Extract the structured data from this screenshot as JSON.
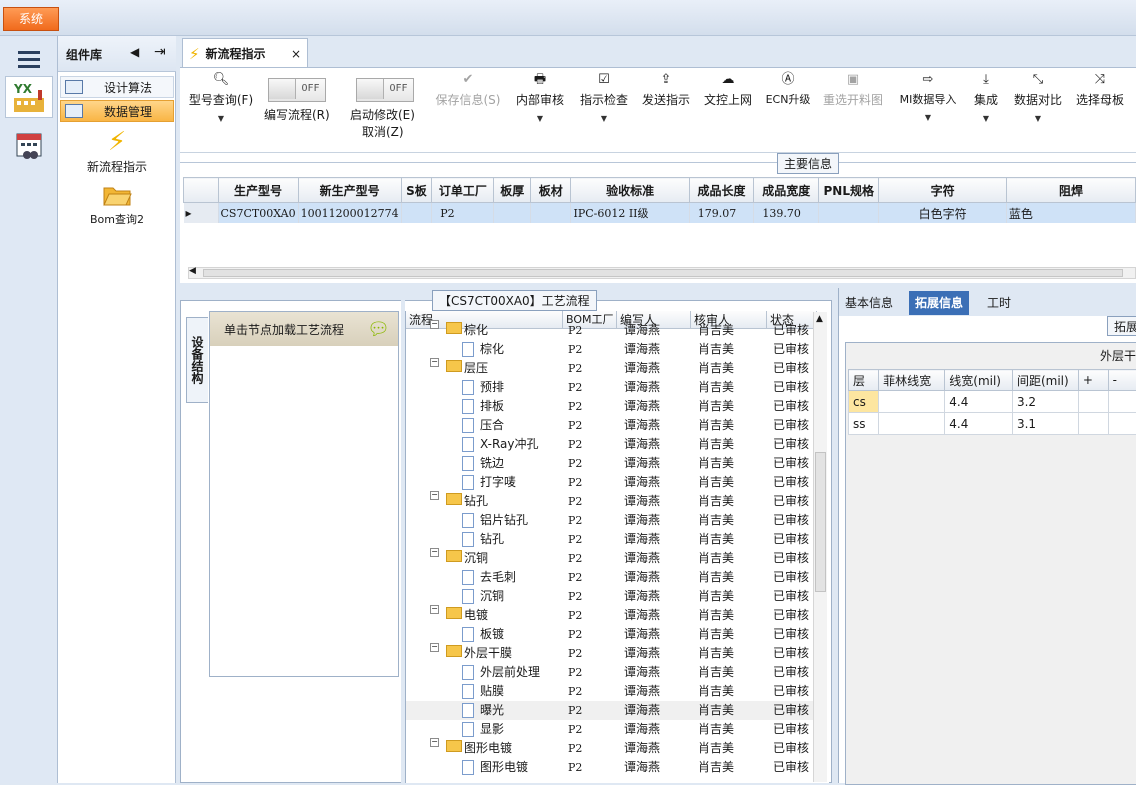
{
  "system_button": "系统",
  "component_panel": {
    "title": "组件库",
    "items": [
      "设计算法",
      "数据管理"
    ],
    "apps": [
      "新流程指示",
      "Bom查询2"
    ]
  },
  "tab": {
    "title": "新流程指示",
    "close": "×"
  },
  "toolbar": {
    "model_query": "型号查询(F)",
    "write_flow": "编写流程(R)",
    "start_modify": "启动修改(E)",
    "cancel": "取消(Z)",
    "toggle_off": "OFF",
    "save_info": "保存信息(S)",
    "internal_review": "内部审核",
    "check": "指示检查",
    "send": "发送指示",
    "upload": "文控上网",
    "ecn": "ECN升级",
    "reselect": "重选开料图",
    "mi_import": "MI数据导入",
    "integrate": "集成",
    "compare": "数据对比",
    "select_mother": "选择母板"
  },
  "main_info": {
    "title": "主要信息",
    "columns": [
      "生产型号",
      "新生产型号",
      "S板",
      "订单工厂",
      "板厚",
      "板材",
      "验收标准",
      "成品长度",
      "成品宽度",
      "PNL规格",
      "字符",
      "阻焊"
    ],
    "row": [
      "CS7CT00XA0",
      "10011200012774",
      "",
      "P2",
      "",
      "",
      "IPC-6012 II级",
      "179.07",
      "139.70",
      "",
      "白色字符",
      "蓝色"
    ]
  },
  "flow": {
    "title": "【CS7CT00XA0】工艺流程",
    "side_tab": "设备结构",
    "load_hint": "单击节点加载工艺流程",
    "columns": [
      "流程",
      "BOM工厂",
      "编写人",
      "核审人",
      "状态"
    ],
    "rows": [
      {
        "name": "棕化",
        "level": 1,
        "folder": true
      },
      {
        "name": "棕化",
        "level": 2,
        "folder": false
      },
      {
        "name": "层压",
        "level": 1,
        "folder": true
      },
      {
        "name": "预排",
        "level": 2,
        "folder": false
      },
      {
        "name": "排板",
        "level": 2,
        "folder": false
      },
      {
        "name": "压合",
        "level": 2,
        "folder": false
      },
      {
        "name": "X-Ray冲孔",
        "level": 2,
        "folder": false
      },
      {
        "name": "铣边",
        "level": 2,
        "folder": false
      },
      {
        "name": "打字唛",
        "level": 2,
        "folder": false
      },
      {
        "name": "钻孔",
        "level": 1,
        "folder": true
      },
      {
        "name": "铝片钻孔",
        "level": 2,
        "folder": false
      },
      {
        "name": "钻孔",
        "level": 2,
        "folder": false
      },
      {
        "name": "沉铜",
        "level": 1,
        "folder": true
      },
      {
        "name": "去毛刺",
        "level": 2,
        "folder": false
      },
      {
        "name": "沉铜",
        "level": 2,
        "folder": false
      },
      {
        "name": "电镀",
        "level": 1,
        "folder": true
      },
      {
        "name": "板镀",
        "level": 2,
        "folder": false
      },
      {
        "name": "外层干膜",
        "level": 1,
        "folder": true
      },
      {
        "name": "外层前处理",
        "level": 2,
        "folder": false
      },
      {
        "name": "贴膜",
        "level": 2,
        "folder": false
      },
      {
        "name": "曝光",
        "level": 2,
        "folder": false,
        "selected": true
      },
      {
        "name": "显影",
        "level": 2,
        "folder": false
      },
      {
        "name": "图形电镀",
        "level": 1,
        "folder": true
      },
      {
        "name": "图形电镀",
        "level": 2,
        "folder": false
      }
    ],
    "bom_factory": "P2",
    "writer": "谭海燕",
    "reviewer": "肖吉美",
    "status": "已审核"
  },
  "right_panel": {
    "tabs": [
      "基本信息",
      "拓展信息",
      "工时"
    ],
    "selected_tab": "拓展信息",
    "sub_button": "拓展",
    "grid_title": "外层干",
    "columns": [
      "层",
      "菲林线宽",
      "线宽(mil)",
      "间距(mil)",
      "+",
      "-"
    ],
    "rows": [
      [
        "cs",
        "",
        "4.4",
        "3.2",
        "",
        ""
      ],
      [
        "ss",
        "",
        "4.4",
        "3.1",
        "",
        ""
      ]
    ]
  }
}
